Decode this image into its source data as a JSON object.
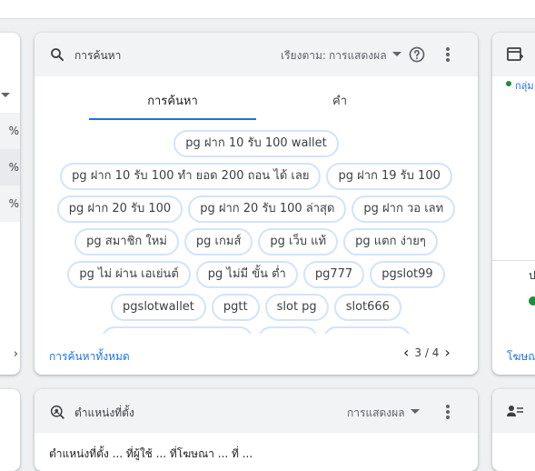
{
  "left_card": {
    "rows": [
      "%",
      "%",
      "%"
    ]
  },
  "search_card": {
    "title": "การค้นหา",
    "sort_label": "เรียงตาม:",
    "sort_value": "การแสดงผล",
    "tabs": [
      {
        "label": "การค้นหา",
        "active": true
      },
      {
        "label": "คำ",
        "active": false
      }
    ],
    "chips": [
      [
        "pg ฝาก 10 รับ 100 wallet"
      ],
      [
        "pg ฝาก 10 รับ 100 ทำ ยอด 200 ถอน ได้ เลย",
        "pg ฝาก 19 รับ 100"
      ],
      [
        "pg ฝาก 20 รับ 100",
        "pg ฝาก 20 รับ 100 ล่าสุด",
        "pg ฝาก วอ เลท"
      ],
      [
        "pg สมาชิก ใหม่",
        "pg เกมส์",
        "pg เว็บ แท้",
        "pg แตก ง่ายๆ"
      ],
      [
        "pg ไม่ ผ่าน เอเย่นต์",
        "pg ไม่มี ขั้น ต่ำ",
        "pg777",
        "pgslot99"
      ],
      [
        "pgslotwallet",
        "pgtt",
        "slot pg",
        "slot666"
      ]
    ],
    "footer_link": "การค้นหาทั้งหมด",
    "pager": "3 / 4",
    "accent": "#1a73e8",
    "chip_border": "#d2e3fc"
  },
  "right_card": {
    "label": "กลุ่ม",
    "text": "ป",
    "link": "โฆษณ"
  },
  "bottom_card": {
    "title": "ตำแหน่งที่ตั้ง",
    "select_value": "การแสดงผล",
    "text": "ตำแหน่งที่ตั้ง ... ที่ผู้ใช้ ... ที่โฆษณา ... ที่ ..."
  }
}
